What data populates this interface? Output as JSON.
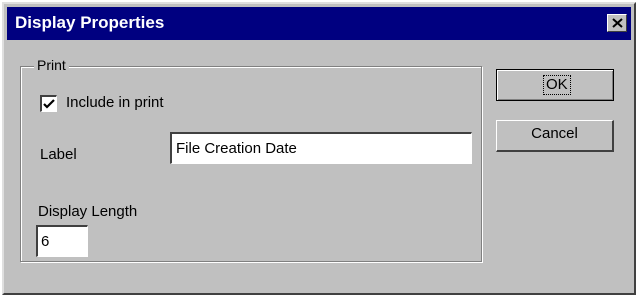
{
  "dialog": {
    "title": "Display Properties",
    "close_icon": "close-icon"
  },
  "print_group": {
    "legend": "Print",
    "include_checkbox": {
      "label": "Include in print",
      "checked": true
    },
    "label_field": {
      "label": "Label",
      "value": "File Creation Date"
    },
    "display_length": {
      "label": "Display Length",
      "value": "6"
    }
  },
  "buttons": {
    "ok_label": "OK",
    "cancel_label": "Cancel"
  },
  "colors": {
    "titlebar": "#000080",
    "dialog_face": "#c0c0c0"
  }
}
